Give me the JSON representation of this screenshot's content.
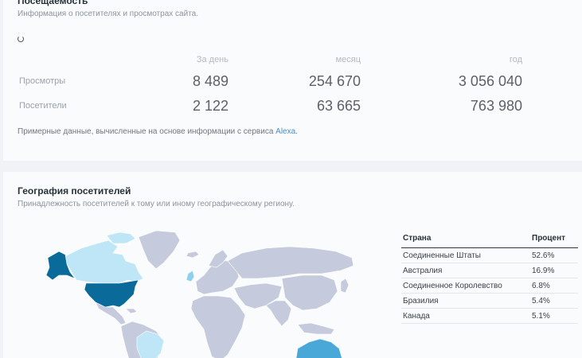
{
  "traffic": {
    "title": "Посещаемость",
    "subtitle": "Информация о посетителях и просмотрах сайта.",
    "columns": [
      "За день",
      "месяц",
      "год"
    ],
    "rows": [
      {
        "label": "Просмотры",
        "day": "8 489",
        "month": "254 670",
        "year": "3 056 040"
      },
      {
        "label": "Посетители",
        "day": "2 122",
        "month": "63 665",
        "year": "763 980"
      }
    ],
    "note_prefix": "Примерные данные, вычисленные на основе информации с сервиса ",
    "note_link": "Alexa",
    "note_suffix": "."
  },
  "geo": {
    "title": "География посетителей",
    "subtitle": "Принадлежность посетителей к тому или иному географическому региону.",
    "table": {
      "headers": [
        "Страна",
        "Процент"
      ],
      "rows": [
        {
          "country": "Соединенные Штаты",
          "percent": "52.6%"
        },
        {
          "country": "Австралия",
          "percent": "16.9%"
        },
        {
          "country": "Соединенное Королевство",
          "percent": "6.8%"
        },
        {
          "country": "Бразилия",
          "percent": "5.4%"
        },
        {
          "country": "Канада",
          "percent": "5.1%"
        }
      ]
    },
    "map_colors": {
      "default": "#c5cbdc",
      "low": "#bfe6f7",
      "mid": "#8fd0ee",
      "high": "#4aa8d8",
      "top": "#1d7fb0",
      "max": "#0a6a9a"
    }
  }
}
